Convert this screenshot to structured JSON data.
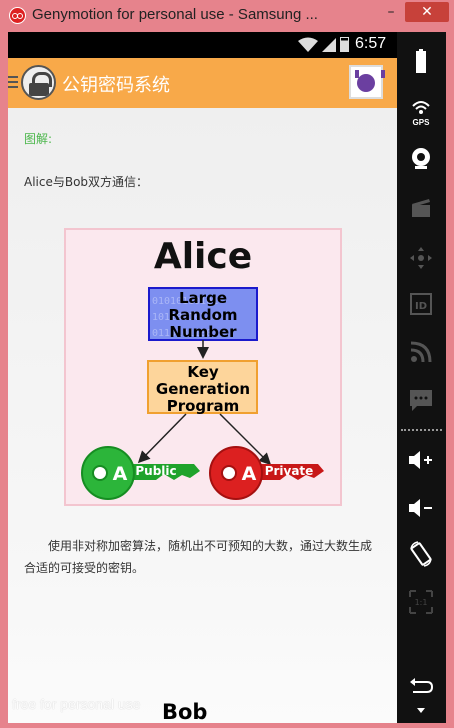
{
  "window": {
    "title": "Genymotion for personal use - Samsung ...",
    "minimize": "–",
    "close": "✕"
  },
  "statusbar": {
    "time": "6:57"
  },
  "appbar": {
    "title": "公钥密码系统"
  },
  "content": {
    "label": "图解:",
    "intro": "Alice与Bob双方通信：",
    "diagram": {
      "name": "Alice",
      "random_line1": "Large",
      "random_line2": "Random",
      "random_line3": "Number",
      "keygen_line1": "Key",
      "keygen_line2": "Generation",
      "keygen_line3": "Program",
      "public_key": "Public",
      "private_key": "Private",
      "key_letter": "A"
    },
    "caption": "使用非对称加密算法，随机出不可预知的大数，通过大数生成合适的可接受的密钥。",
    "next_heading": "Bob"
  },
  "watermark": "free for personal use",
  "sidebar": {
    "gps_label": "GPS",
    "icons": [
      "battery-icon",
      "gps-icon",
      "camera-icon",
      "clapper-icon",
      "dpad-icon",
      "id-icon",
      "rss-icon",
      "sms-icon",
      "volume-up-icon",
      "volume-down-icon",
      "rotate-icon",
      "scale-icon",
      "back-icon"
    ]
  },
  "colors": {
    "appbar": "#f8a949",
    "random_box": "#7d8ff0",
    "keygen_box": "#fdd59b",
    "public_key": "#1fa32b",
    "private_key": "#d81b1b"
  }
}
